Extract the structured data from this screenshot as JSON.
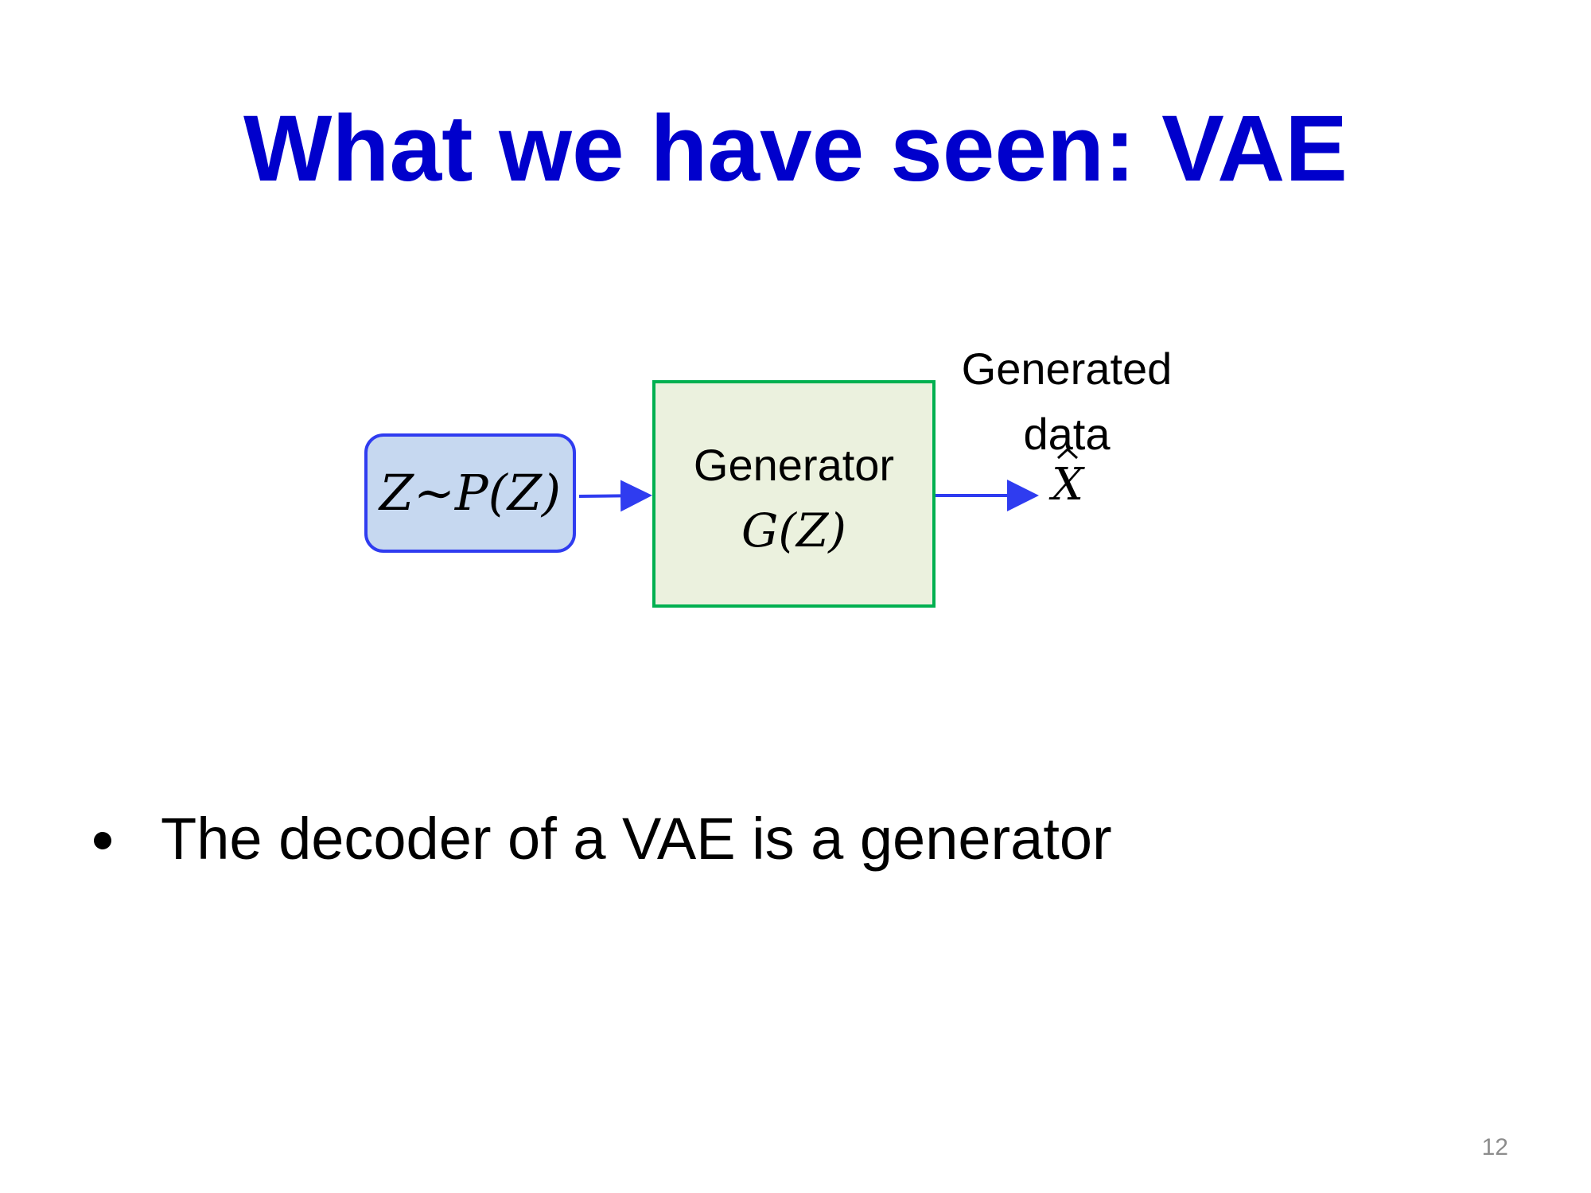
{
  "slide": {
    "title": "What we have seen: VAE",
    "page_number": "12"
  },
  "diagram": {
    "input": {
      "label": "Z∼P(Z)"
    },
    "generator": {
      "title": "Generator",
      "expression": "G(Z)"
    },
    "output": {
      "label_line_1": "Generated",
      "label_line_2": "data",
      "symbol": "X"
    },
    "colors": {
      "arrow": "#2f3cf0",
      "input_border": "#2f3cf0",
      "input_fill": "#c6d8f0",
      "generator_border": "#00b050",
      "generator_fill": "#ebf1de",
      "title": "#0000cc"
    }
  },
  "bullets": [
    "The decoder of a VAE is a generator"
  ]
}
